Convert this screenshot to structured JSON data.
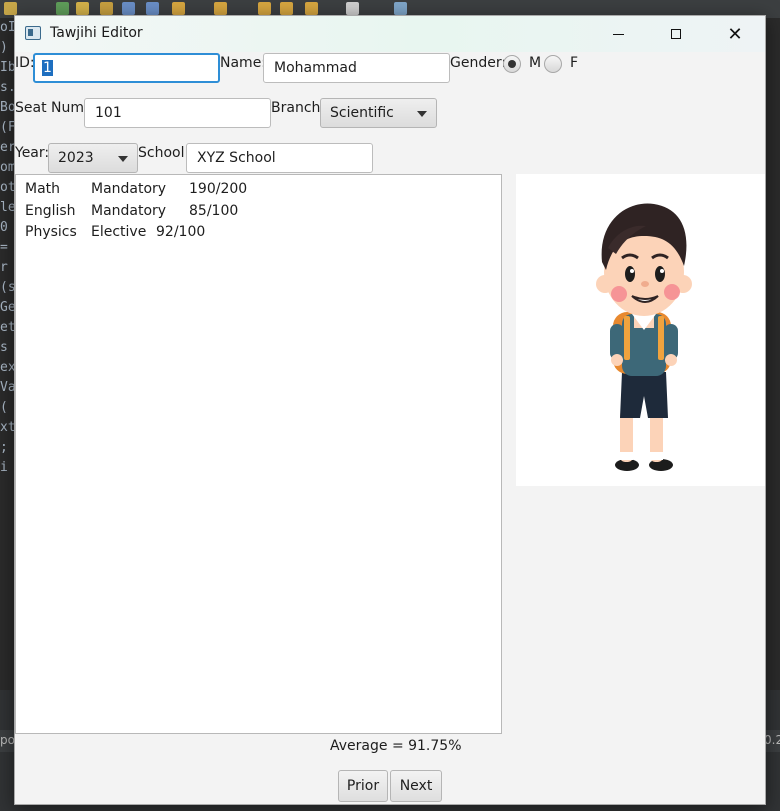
{
  "window": {
    "title": "Tawjihi Editor"
  },
  "form": {
    "id_label": "ID:",
    "id_value": "1",
    "name_label": "Name:",
    "name_value": "Mohammad",
    "gender_label": "Gender:",
    "gender_options": [
      "M",
      "F"
    ],
    "gender_selected": "M",
    "seat_label": "Seat Num:",
    "seat_value": "101",
    "branch_label": "Branch:",
    "branch_value": "Scientific",
    "year_label": "Year:",
    "year_value": "2023",
    "school_label": "School:",
    "school_value": "XYZ School"
  },
  "subjects": [
    {
      "name": "Math",
      "type": "Mandatory",
      "score": "190/200"
    },
    {
      "name": "English",
      "type": "Mandatory",
      "score": "85/100"
    },
    {
      "name": "Physics",
      "type": "Elective",
      "score": "92/100"
    }
  ],
  "average_text": "Average = 91.75%",
  "buttons": {
    "prior": "Prior",
    "next": "Next"
  },
  "ide_background": {
    "code_fragments": [
      "oID",
      ")",
      "Ib",
      "s.",
      "Bo",
      "(F",
      "",
      "er",
      "om",
      "",
      "ot",
      "",
      "",
      "le",
      "0",
      "=",
      "",
      "r",
      "(s",
      "Ge",
      "et",
      "",
      "s",
      "",
      "ex",
      "Va",
      "(",
      "xt",
      ";",
      "i"
    ],
    "status_left": "po",
    "status_right": "0.2"
  }
}
